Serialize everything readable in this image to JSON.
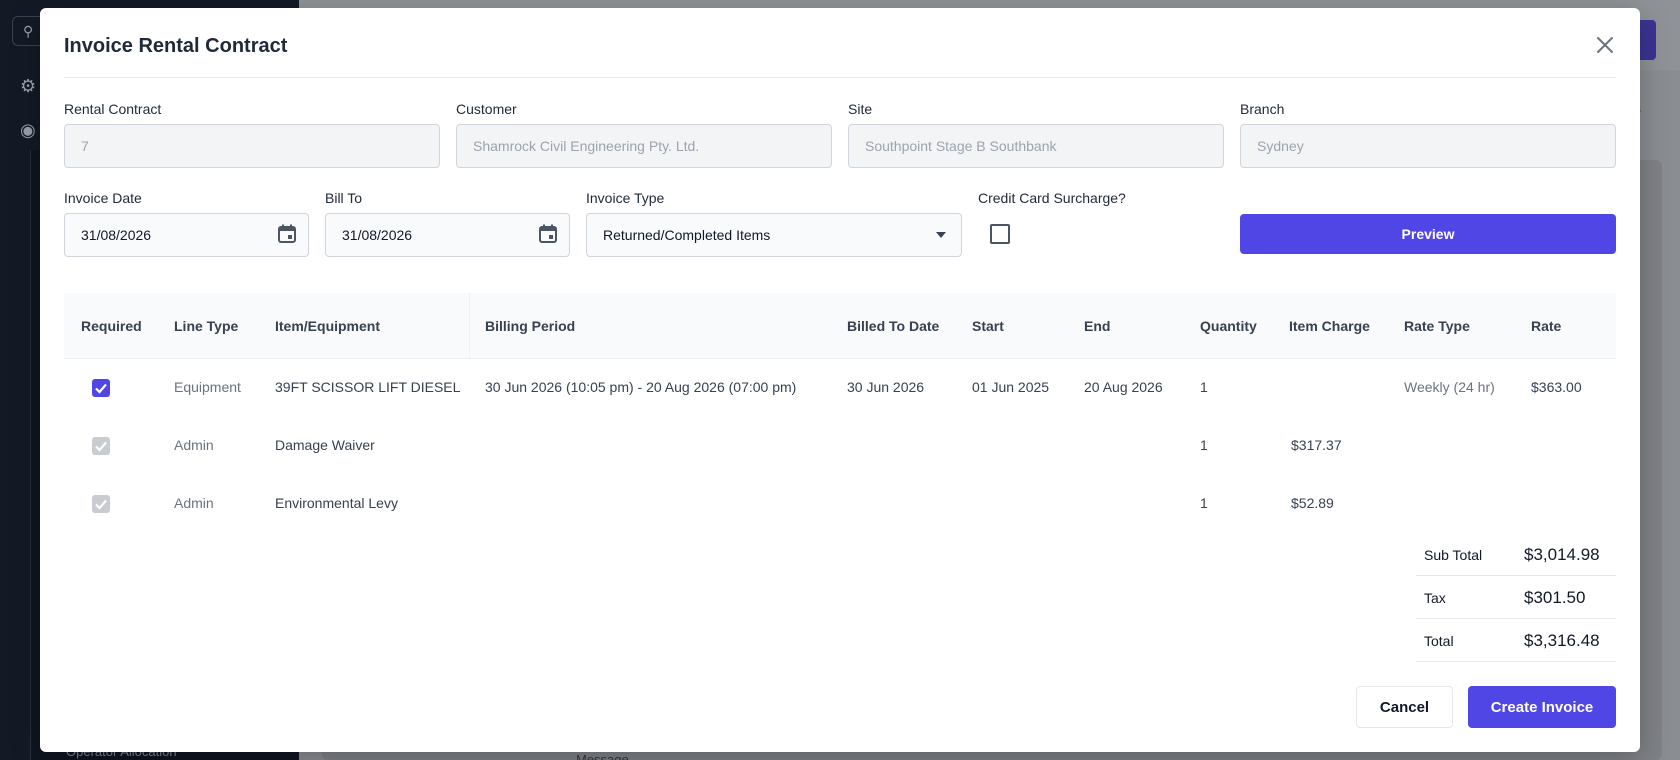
{
  "background": {
    "sidebar_item": "Operator Allocation",
    "main_text": "Message",
    "side_text": "s"
  },
  "modal": {
    "title": "Invoice Rental Contract",
    "fields": {
      "rental_contract": {
        "label": "Rental Contract",
        "value": "7"
      },
      "customer": {
        "label": "Customer",
        "value": "Shamrock Civil Engineering Pty. Ltd."
      },
      "site": {
        "label": "Site",
        "value": "Southpoint Stage B Southbank"
      },
      "branch": {
        "label": "Branch",
        "value": "Sydney"
      },
      "invoice_date": {
        "label": "Invoice Date",
        "value": "31/08/2026"
      },
      "bill_to": {
        "label": "Bill To",
        "value": "31/08/2026"
      },
      "invoice_type": {
        "label": "Invoice Type",
        "value": "Returned/Completed Items"
      },
      "credit_card_surcharge": {
        "label": "Credit Card Surcharge?"
      }
    },
    "preview_label": "Preview",
    "table": {
      "columns": [
        "Required",
        "Line Type",
        "Item/Equipment",
        "Billing Period",
        "Billed To Date",
        "Start",
        "End",
        "Quantity",
        "Item Charge",
        "Rate Type",
        "Rate"
      ],
      "rows": [
        {
          "line_type": "Equipment",
          "item": "39FT SCISSOR LIFT DIESEL",
          "billing_period": "30 Jun 2026 (10:05 pm) - 20 Aug 2026 (07:00 pm)",
          "billed_to": "30 Jun 2026",
          "start": "01 Jun 2025",
          "end": "20 Aug 2026",
          "quantity": "1",
          "item_charge": "",
          "rate_type": "Weekly (24 hr)",
          "rate": "$363.00"
        },
        {
          "line_type": "Admin",
          "item": "Damage Waiver",
          "billing_period": "",
          "billed_to": "",
          "start": "",
          "end": "",
          "quantity": "1",
          "item_charge": "$317.37",
          "rate_type": "",
          "rate": ""
        },
        {
          "line_type": "Admin",
          "item": "Environmental Levy",
          "billing_period": "",
          "billed_to": "",
          "start": "",
          "end": "",
          "quantity": "1",
          "item_charge": "$52.89",
          "rate_type": "",
          "rate": ""
        }
      ]
    },
    "totals": {
      "subtotal_label": "Sub Total",
      "subtotal": "$3,014.98",
      "tax_label": "Tax",
      "tax": "$301.50",
      "total_label": "Total",
      "total": "$3,316.48"
    },
    "cancel_label": "Cancel",
    "create_label": "Create Invoice"
  },
  "colors": {
    "accent": "#4f46e5",
    "sidebar": "#131a26"
  }
}
